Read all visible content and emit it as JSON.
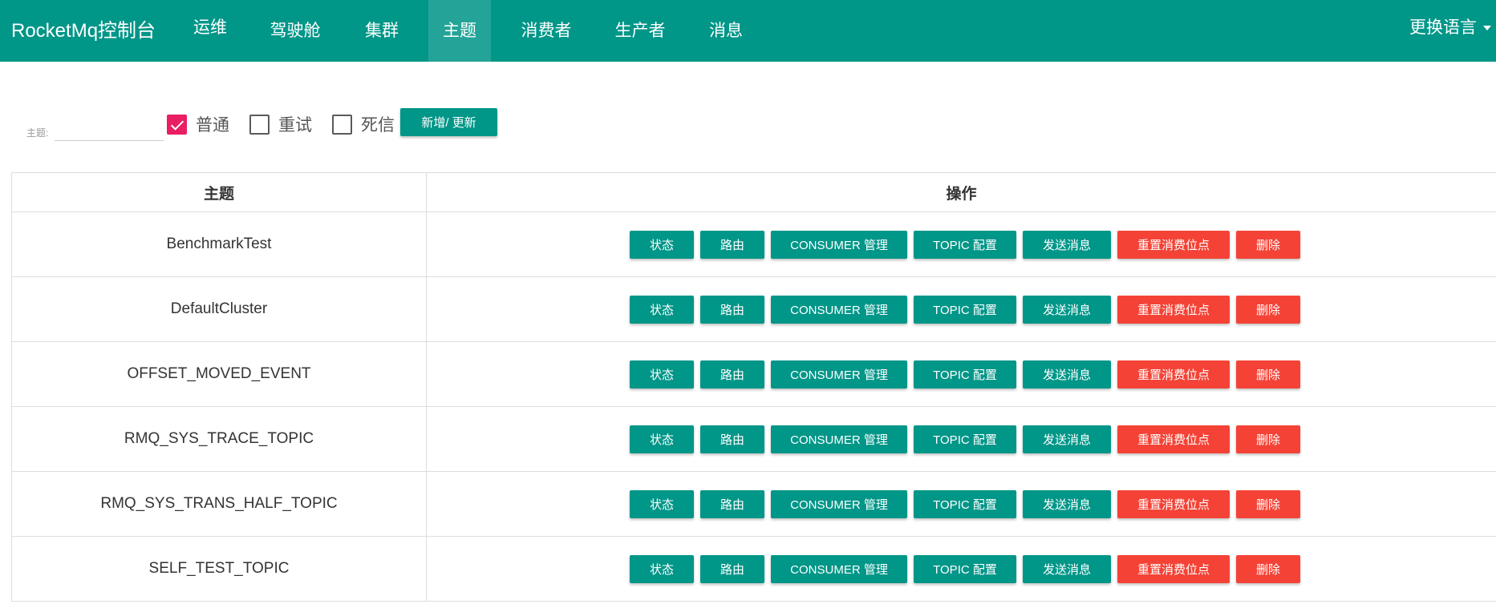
{
  "navbar": {
    "brand": "RocketMq控制台",
    "items": [
      "运维",
      "驾驶舱",
      "集群",
      "主题",
      "消费者",
      "生产者",
      "消息"
    ],
    "active": "主题",
    "language": "更换语言"
  },
  "filter": {
    "label": "主题:",
    "value": "",
    "checkboxes": [
      {
        "label": "普通",
        "checked": true
      },
      {
        "label": "重试",
        "checked": false
      },
      {
        "label": "死信",
        "checked": false
      }
    ],
    "add_button": "新增/ 更新"
  },
  "table": {
    "headers": [
      "主题",
      "操作"
    ],
    "rows": [
      {
        "topic": "BenchmarkTest"
      },
      {
        "topic": "DefaultCluster"
      },
      {
        "topic": "OFFSET_MOVED_EVENT"
      },
      {
        "topic": "RMQ_SYS_TRACE_TOPIC"
      },
      {
        "topic": "RMQ_SYS_TRANS_HALF_TOPIC"
      },
      {
        "topic": "SELF_TEST_TOPIC"
      }
    ],
    "actions": [
      {
        "label": "状态",
        "color": "teal"
      },
      {
        "label": "路由",
        "color": "teal"
      },
      {
        "label": "CONSUMER 管理",
        "color": "teal"
      },
      {
        "label": "TOPIC 配置",
        "color": "teal"
      },
      {
        "label": "发送消息",
        "color": "teal"
      },
      {
        "label": "重置消费位点",
        "color": "red"
      },
      {
        "label": "删除",
        "color": "red"
      }
    ]
  },
  "colors": {
    "primary": "#009688",
    "danger": "#f44336",
    "checkbox": "#e91e63"
  }
}
